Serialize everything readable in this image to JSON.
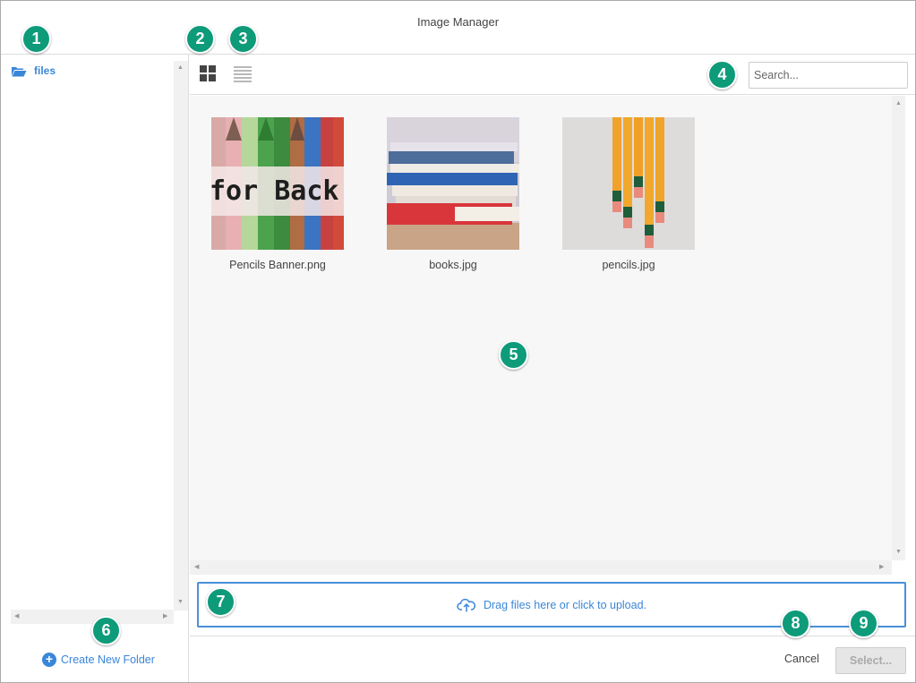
{
  "dialog": {
    "title": "Image Manager"
  },
  "sidebar": {
    "folder_label": "files",
    "create_folder_label": "Create New Folder"
  },
  "toolbar": {
    "grid_view_icon": "grid-view-icon",
    "list_view_icon": "list-view-icon",
    "search_placeholder": "Search..."
  },
  "files": [
    {
      "name": "Pencils Banner.png",
      "thumb_text": "for Back to"
    },
    {
      "name": "books.jpg"
    },
    {
      "name": "pencils.jpg"
    }
  ],
  "upload": {
    "label": "Drag files here or click to upload."
  },
  "footer": {
    "cancel_label": "Cancel",
    "select_label": "Select..."
  },
  "badges": [
    "1",
    "2",
    "3",
    "4",
    "5",
    "6",
    "7",
    "8",
    "9"
  ],
  "colors": {
    "accent": "#3a86d8",
    "badge": "#0e9b7a",
    "content_bg": "#f7f7f7"
  }
}
